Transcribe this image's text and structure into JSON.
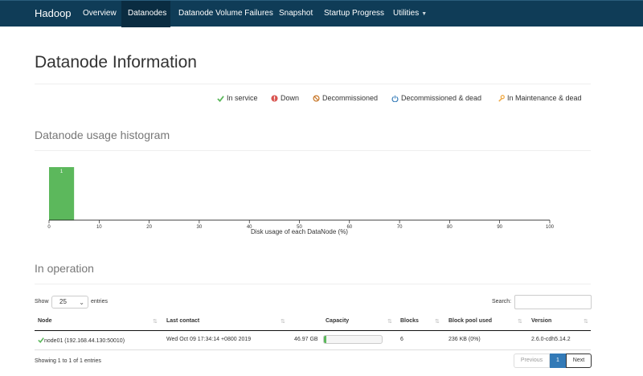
{
  "navbar": {
    "brand": "Hadoop",
    "items": [
      {
        "label": "Overview"
      },
      {
        "label": "Datanodes",
        "active": true
      },
      {
        "label": "Datanode Volume Failures"
      },
      {
        "label": "Snapshot"
      },
      {
        "label": "Startup Progress"
      },
      {
        "label": "Utilities",
        "dropdown": true
      }
    ]
  },
  "page_title": "Datanode Information",
  "legend": [
    {
      "icon": "check-icon",
      "label": "In service",
      "color": "#5cb85c"
    },
    {
      "icon": "exclamation-icon",
      "label": "Down",
      "color": "#d9534f"
    },
    {
      "icon": "ban-icon",
      "label": "Decommissioned",
      "color": "#c8782a"
    },
    {
      "icon": "power-icon",
      "label": "Decommissioned & dead",
      "color": "#337ab7"
    },
    {
      "icon": "wrench-icon",
      "label": "In Maintenance & dead",
      "color": "#f0ad4e"
    }
  ],
  "histogram": {
    "title": "Datanode usage histogram",
    "chart_data": {
      "type": "bar",
      "bins": [
        [
          0,
          5
        ]
      ],
      "values": [
        1
      ],
      "xlabel": "Disk usage of each DataNode (%)",
      "xlim": [
        0,
        100
      ],
      "xticks": [
        0,
        10,
        20,
        30,
        40,
        50,
        60,
        70,
        80,
        90,
        100
      ],
      "grid": false,
      "color": "#5cb85c"
    }
  },
  "operation": {
    "title": "In operation",
    "show_label": "Show",
    "page_size": "25",
    "entries_label": "entries",
    "search_label": "Search:",
    "columns": [
      "Node",
      "Last contact",
      "Capacity",
      "Blocks",
      "Block pool used",
      "Version"
    ],
    "rows": [
      {
        "node": "node01 (192.168.44.130:50010)",
        "last_contact": "Wed Oct 09 17:34:14 +0800 2019",
        "capacity": "46.97 GB",
        "capacity_used_fraction": 0.04,
        "blocks": "6",
        "block_pool_used": "236 KB (0%)",
        "version": "2.6.0-cdh5.14.2"
      }
    ],
    "info": "Showing 1 to 1 of 1 entries",
    "pagination": {
      "previous": "Previous",
      "current": "1",
      "next": "Next"
    }
  }
}
